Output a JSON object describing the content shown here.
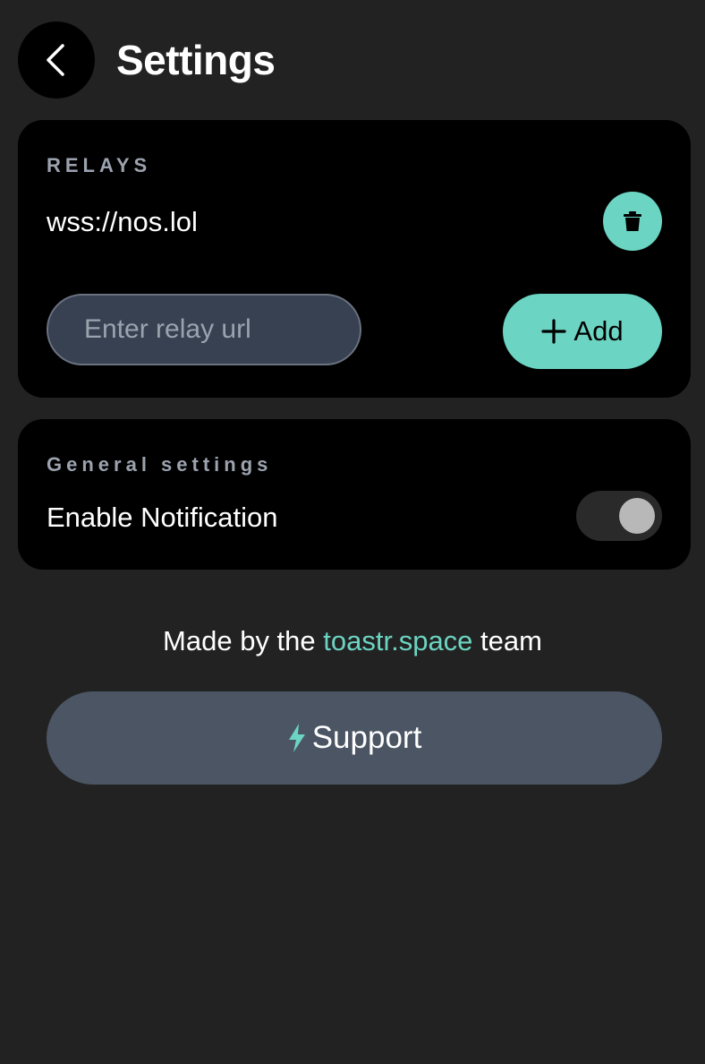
{
  "header": {
    "title": "Settings",
    "back_icon": "chevron-left-icon"
  },
  "relays": {
    "section_label": "RELAYS",
    "items": [
      {
        "url": "wss://nos.lol",
        "delete_icon": "trash-icon"
      }
    ],
    "input_placeholder": "Enter relay url",
    "input_value": "",
    "add_label": "Add",
    "add_icon": "plus-icon"
  },
  "general": {
    "section_label": "General settings",
    "notification_label": "Enable Notification",
    "notification_enabled": false
  },
  "footer": {
    "credit_prefix": "Made by the ",
    "credit_link": "toastr.space",
    "credit_suffix": " team",
    "support_label": "Support",
    "support_icon": "lightning-icon"
  },
  "colors": {
    "background": "#222222",
    "card": "#000000",
    "accent": "#6cd4c2",
    "support_button": "#4b5563",
    "input_bg": "#374151"
  }
}
